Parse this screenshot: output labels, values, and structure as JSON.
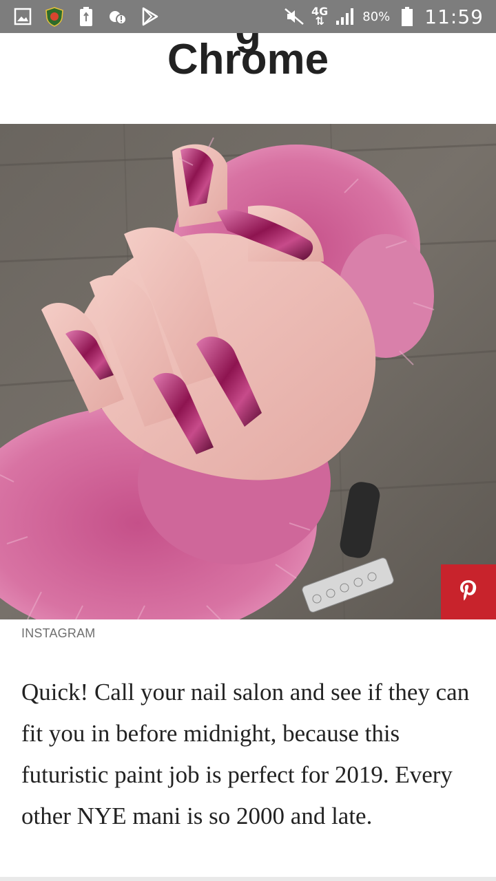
{
  "status_bar": {
    "battery_percent": "80%",
    "network": "4G",
    "time": "11:59",
    "icons": [
      "gallery-icon",
      "shield-app-icon",
      "battery-recycle-icon",
      "cloud-alert-icon",
      "play-store-icon",
      "mute-icon",
      "signal-icon",
      "battery-icon"
    ]
  },
  "article": {
    "headline_fragment": "Chrome",
    "image": {
      "credit": "INSTAGRAM",
      "pin_icon": "pinterest-icon"
    },
    "paragraph": "Quick! Call your nail salon and see if they can fit you in before midnight, because this futuristic paint job is perfect for 2019. Every other NYE mani is so 2000 and late."
  },
  "colors": {
    "status_bar": "#7d7d7d",
    "pinterest_red": "#c8232c",
    "text": "#222222",
    "fur_pink": "#d46a9b",
    "nail_magenta": "#9a1f5a"
  }
}
